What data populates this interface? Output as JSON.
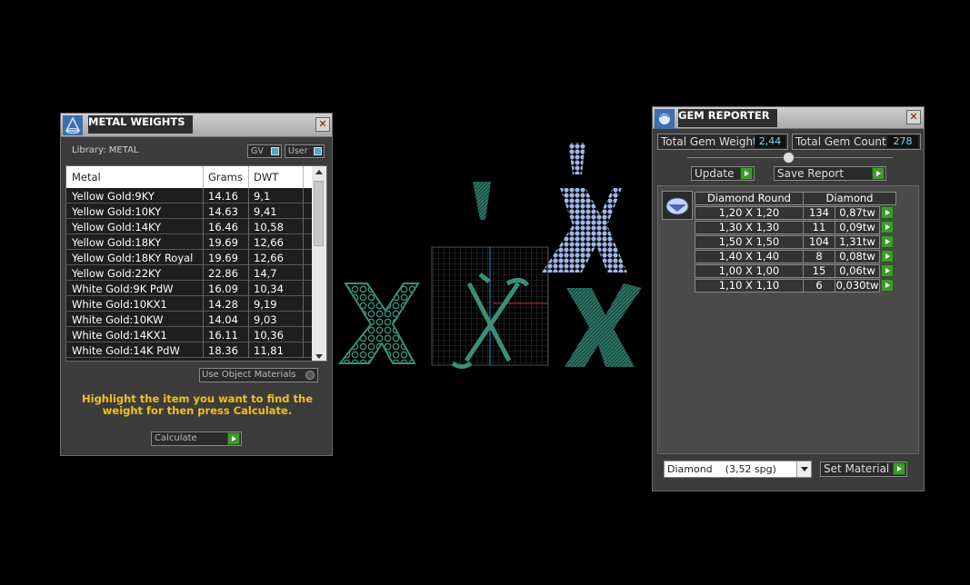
{
  "metal_weights": {
    "title": "METAL WEIGHTS",
    "library_label": "Library: METAL",
    "gv_label": "GV",
    "user_label": "User",
    "columns": [
      "Metal",
      "Grams",
      "DWT"
    ],
    "rows": [
      [
        "Yellow Gold:9KY",
        "14.16",
        "9,1"
      ],
      [
        "Yellow Gold:10KY",
        "14.63",
        "9,41"
      ],
      [
        "Yellow Gold:14KY",
        "16.46",
        "10,58"
      ],
      [
        "Yellow Gold:18KY",
        "19.69",
        "12,66"
      ],
      [
        "Yellow Gold:18KY Royal",
        "19.69",
        "12,66"
      ],
      [
        "Yellow Gold:22KY",
        "22.86",
        "14,7"
      ],
      [
        "White Gold:9K PdW",
        "16.09",
        "10,34"
      ],
      [
        "White Gold:10KX1",
        "14.28",
        "9,19"
      ],
      [
        "White Gold:10KW",
        "14.04",
        "9,03"
      ],
      [
        "White Gold:14KX1",
        "16.11",
        "10,36"
      ],
      [
        "White Gold:14K PdW",
        "18.36",
        "11,81"
      ]
    ],
    "use_object_materials": "Use Object Materials",
    "hint": "Highlight the item you want to find the weight for then press Calculate.",
    "calculate_label": "Calculate"
  },
  "gem_reporter": {
    "title": "GEM REPORTER",
    "total_weight_label": "Total Gem Weight",
    "total_weight_value": "2,44",
    "total_count_label": "Total Gem Count",
    "total_count_value": "278",
    "update_label": "Update",
    "save_report_label": "Save Report",
    "headers": [
      "Diamond Round",
      "Diamond"
    ],
    "rows": [
      [
        "1,20 X 1,20",
        "134",
        "0,87tw"
      ],
      [
        "1,30 X 1,30",
        "11",
        "0,09tw"
      ],
      [
        "1,50 X 1,50",
        "104",
        "1,31tw"
      ],
      [
        "1,40 X 1,40",
        "8",
        "0,08tw"
      ],
      [
        "1,00 X 1,00",
        "15",
        "0,06tw"
      ],
      [
        "1,10 X 1,10",
        "6",
        "0,030tw"
      ]
    ],
    "material_select": "Diamond    (3,52 spg)",
    "set_material_label": "Set Material"
  },
  "colors": {
    "accent_green": "#3f9a2e",
    "hint_yellow": "#f2c21b",
    "mesh_teal": "#3b8f78",
    "gem_blue": "#9fb6e6"
  }
}
